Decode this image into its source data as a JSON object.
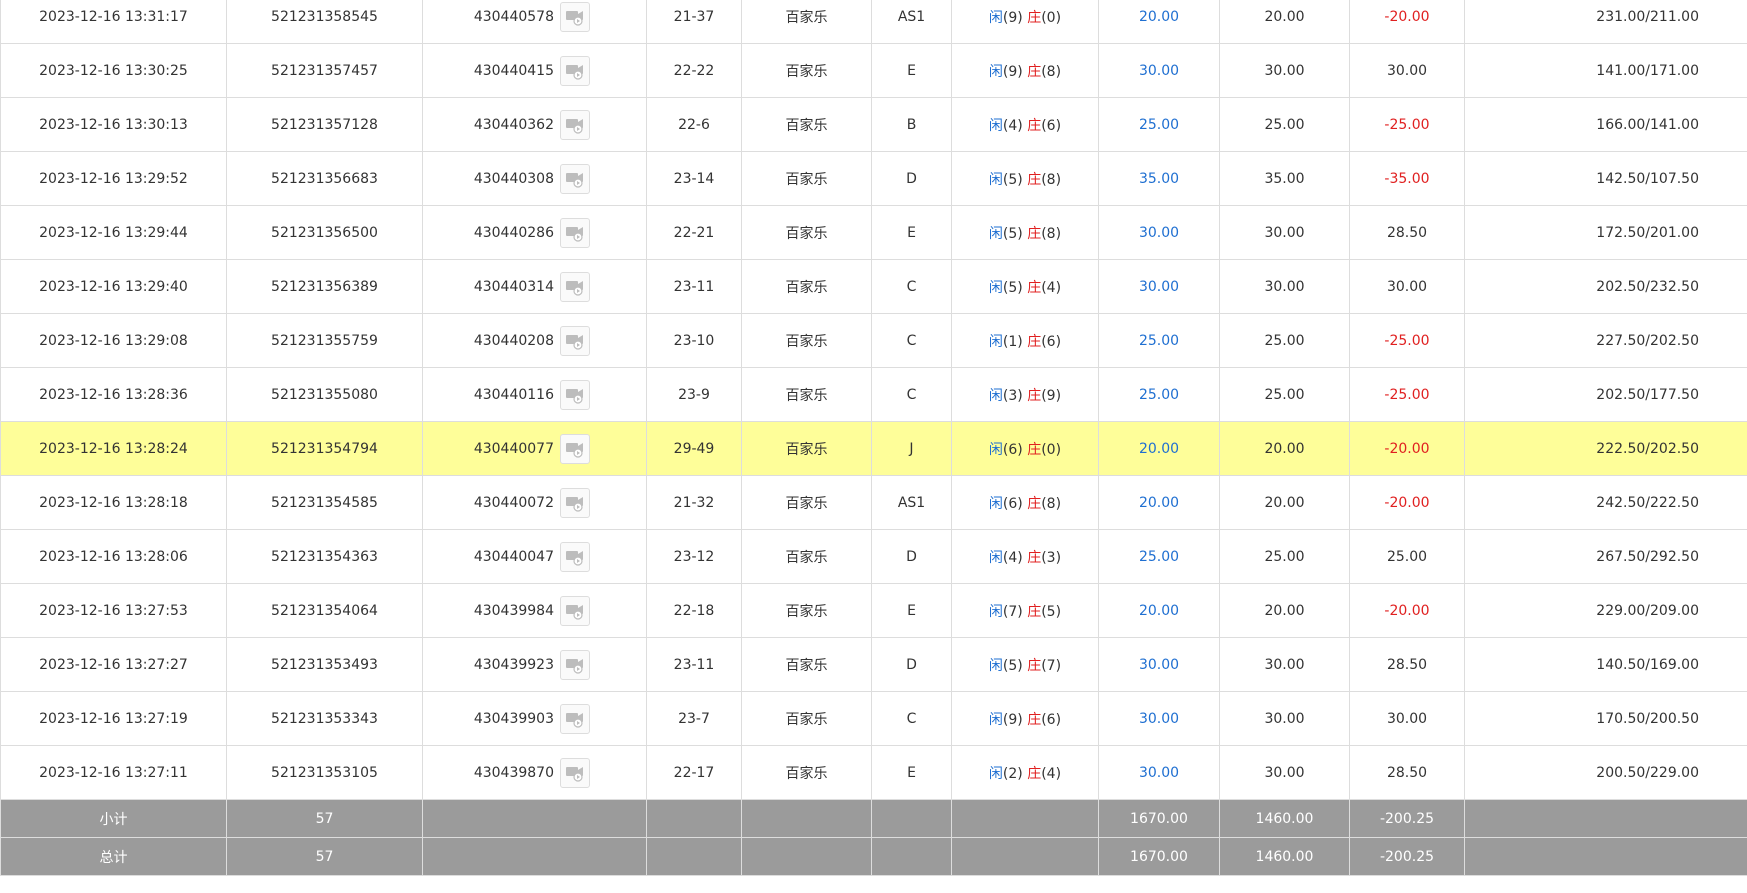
{
  "colors": {
    "player": "#1f6fd1",
    "banker": "#e02020",
    "highlight": "#fefe99",
    "summary_bg": "#9b9b9b"
  },
  "rows": [
    {
      "time": "2023-12-16 13:31:17",
      "order": "521231358545",
      "game": "430440578",
      "shoe": "21-37",
      "type": "百家乐",
      "table": "AS1",
      "player_label": "闲",
      "player_score": "(9)",
      "banker_label": "庄",
      "banker_score": "(0)",
      "bet": "20.00",
      "valid": "20.00",
      "win": "-20.00",
      "win_neg": true,
      "balance": "231.00/211.00",
      "highlight": false
    },
    {
      "time": "2023-12-16 13:30:25",
      "order": "521231357457",
      "game": "430440415",
      "shoe": "22-22",
      "type": "百家乐",
      "table": "E",
      "player_label": "闲",
      "player_score": "(9)",
      "banker_label": "庄",
      "banker_score": "(8)",
      "bet": "30.00",
      "valid": "30.00",
      "win": "30.00",
      "win_neg": false,
      "balance": "141.00/171.00",
      "highlight": false
    },
    {
      "time": "2023-12-16 13:30:13",
      "order": "521231357128",
      "game": "430440362",
      "shoe": "22-6",
      "type": "百家乐",
      "table": "B",
      "player_label": "闲",
      "player_score": "(4)",
      "banker_label": "庄",
      "banker_score": "(6)",
      "bet": "25.00",
      "valid": "25.00",
      "win": "-25.00",
      "win_neg": true,
      "balance": "166.00/141.00",
      "highlight": false
    },
    {
      "time": "2023-12-16 13:29:52",
      "order": "521231356683",
      "game": "430440308",
      "shoe": "23-14",
      "type": "百家乐",
      "table": "D",
      "player_label": "闲",
      "player_score": "(5)",
      "banker_label": "庄",
      "banker_score": "(8)",
      "bet": "35.00",
      "valid": "35.00",
      "win": "-35.00",
      "win_neg": true,
      "balance": "142.50/107.50",
      "highlight": false
    },
    {
      "time": "2023-12-16 13:29:44",
      "order": "521231356500",
      "game": "430440286",
      "shoe": "22-21",
      "type": "百家乐",
      "table": "E",
      "player_label": "闲",
      "player_score": "(5)",
      "banker_label": "庄",
      "banker_score": "(8)",
      "bet": "30.00",
      "valid": "30.00",
      "win": "28.50",
      "win_neg": false,
      "balance": "172.50/201.00",
      "highlight": false
    },
    {
      "time": "2023-12-16 13:29:40",
      "order": "521231356389",
      "game": "430440314",
      "shoe": "23-11",
      "type": "百家乐",
      "table": "C",
      "player_label": "闲",
      "player_score": "(5)",
      "banker_label": "庄",
      "banker_score": "(4)",
      "bet": "30.00",
      "valid": "30.00",
      "win": "30.00",
      "win_neg": false,
      "balance": "202.50/232.50",
      "highlight": false
    },
    {
      "time": "2023-12-16 13:29:08",
      "order": "521231355759",
      "game": "430440208",
      "shoe": "23-10",
      "type": "百家乐",
      "table": "C",
      "player_label": "闲",
      "player_score": "(1)",
      "banker_label": "庄",
      "banker_score": "(6)",
      "bet": "25.00",
      "valid": "25.00",
      "win": "-25.00",
      "win_neg": true,
      "balance": "227.50/202.50",
      "highlight": false
    },
    {
      "time": "2023-12-16 13:28:36",
      "order": "521231355080",
      "game": "430440116",
      "shoe": "23-9",
      "type": "百家乐",
      "table": "C",
      "player_label": "闲",
      "player_score": "(3)",
      "banker_label": "庄",
      "banker_score": "(9)",
      "bet": "25.00",
      "valid": "25.00",
      "win": "-25.00",
      "win_neg": true,
      "balance": "202.50/177.50",
      "highlight": false
    },
    {
      "time": "2023-12-16 13:28:24",
      "order": "521231354794",
      "game": "430440077",
      "shoe": "29-49",
      "type": "百家乐",
      "table": "J",
      "player_label": "闲",
      "player_score": "(6)",
      "banker_label": "庄",
      "banker_score": "(0)",
      "bet": "20.00",
      "valid": "20.00",
      "win": "-20.00",
      "win_neg": true,
      "balance": "222.50/202.50",
      "highlight": true
    },
    {
      "time": "2023-12-16 13:28:18",
      "order": "521231354585",
      "game": "430440072",
      "shoe": "21-32",
      "type": "百家乐",
      "table": "AS1",
      "player_label": "闲",
      "player_score": "(6)",
      "banker_label": "庄",
      "banker_score": "(8)",
      "bet": "20.00",
      "valid": "20.00",
      "win": "-20.00",
      "win_neg": true,
      "balance": "242.50/222.50",
      "highlight": false
    },
    {
      "time": "2023-12-16 13:28:06",
      "order": "521231354363",
      "game": "430440047",
      "shoe": "23-12",
      "type": "百家乐",
      "table": "D",
      "player_label": "闲",
      "player_score": "(4)",
      "banker_label": "庄",
      "banker_score": "(3)",
      "bet": "25.00",
      "valid": "25.00",
      "win": "25.00",
      "win_neg": false,
      "balance": "267.50/292.50",
      "highlight": false
    },
    {
      "time": "2023-12-16 13:27:53",
      "order": "521231354064",
      "game": "430439984",
      "shoe": "22-18",
      "type": "百家乐",
      "table": "E",
      "player_label": "闲",
      "player_score": "(7)",
      "banker_label": "庄",
      "banker_score": "(5)",
      "bet": "20.00",
      "valid": "20.00",
      "win": "-20.00",
      "win_neg": true,
      "balance": "229.00/209.00",
      "highlight": false
    },
    {
      "time": "2023-12-16 13:27:27",
      "order": "521231353493",
      "game": "430439923",
      "shoe": "23-11",
      "type": "百家乐",
      "table": "D",
      "player_label": "闲",
      "player_score": "(5)",
      "banker_label": "庄",
      "banker_score": "(7)",
      "bet": "30.00",
      "valid": "30.00",
      "win": "28.50",
      "win_neg": false,
      "balance": "140.50/169.00",
      "highlight": false
    },
    {
      "time": "2023-12-16 13:27:19",
      "order": "521231353343",
      "game": "430439903",
      "shoe": "23-7",
      "type": "百家乐",
      "table": "C",
      "player_label": "闲",
      "player_score": "(9)",
      "banker_label": "庄",
      "banker_score": "(6)",
      "bet": "30.00",
      "valid": "30.00",
      "win": "30.00",
      "win_neg": false,
      "balance": "170.50/200.50",
      "highlight": false
    },
    {
      "time": "2023-12-16 13:27:11",
      "order": "521231353105",
      "game": "430439870",
      "shoe": "22-17",
      "type": "百家乐",
      "table": "E",
      "player_label": "闲",
      "player_score": "(2)",
      "banker_label": "庄",
      "banker_score": "(4)",
      "bet": "30.00",
      "valid": "30.00",
      "win": "28.50",
      "win_neg": false,
      "balance": "200.50/229.00",
      "highlight": false
    }
  ],
  "summary": {
    "subtotal": {
      "label": "小计",
      "count": "57",
      "bet": "1670.00",
      "valid": "1460.00",
      "win": "-200.25"
    },
    "total": {
      "label": "总计",
      "count": "57",
      "bet": "1670.00",
      "valid": "1460.00",
      "win": "-200.25"
    }
  }
}
